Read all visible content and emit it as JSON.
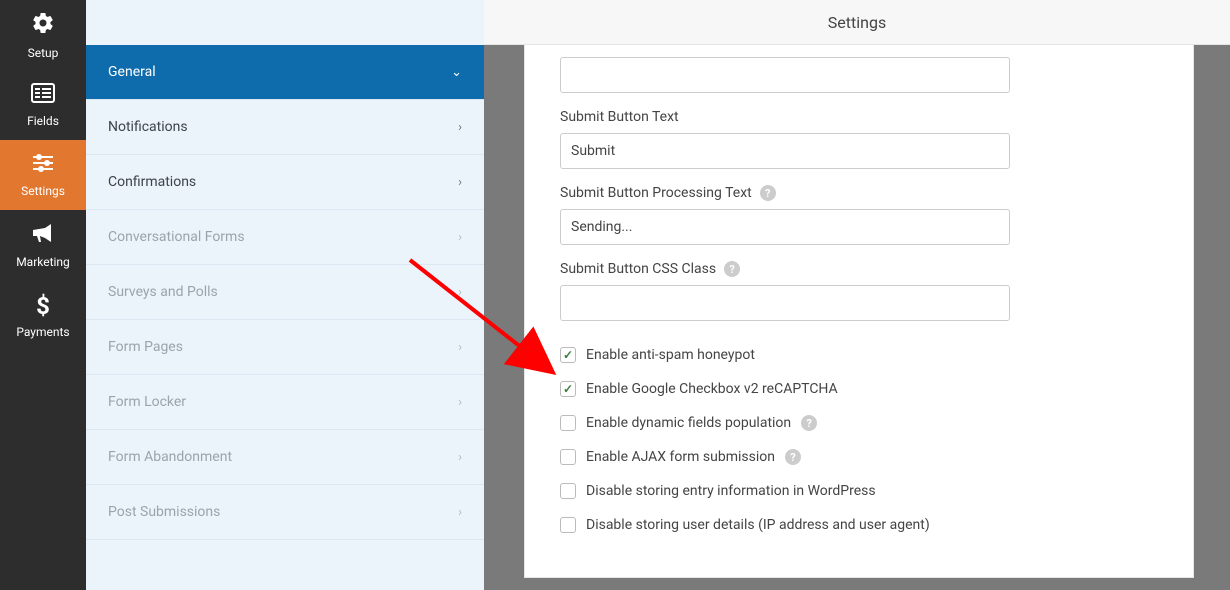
{
  "sidebar": {
    "items": [
      {
        "label": "Setup"
      },
      {
        "label": "Fields"
      },
      {
        "label": "Settings"
      },
      {
        "label": "Marketing"
      },
      {
        "label": "Payments"
      }
    ]
  },
  "panel": {
    "items": [
      {
        "label": "General",
        "active": true,
        "expanded": true
      },
      {
        "label": "Notifications"
      },
      {
        "label": "Confirmations"
      },
      {
        "label": "Conversational Forms",
        "muted": true
      },
      {
        "label": "Surveys and Polls",
        "muted": true
      },
      {
        "label": "Form Pages",
        "muted": true
      },
      {
        "label": "Form Locker",
        "muted": true
      },
      {
        "label": "Form Abandonment",
        "muted": true
      },
      {
        "label": "Post Submissions",
        "muted": true
      }
    ]
  },
  "header": {
    "title": "Settings"
  },
  "form": {
    "submit_text_label": "Submit Button Text",
    "submit_text_value": "Submit",
    "processing_label": "Submit Button Processing Text",
    "processing_value": "Sending...",
    "css_class_label": "Submit Button CSS Class",
    "css_class_value": ""
  },
  "checkboxes": [
    {
      "label": "Enable anti-spam honeypot",
      "checked": true,
      "help": false
    },
    {
      "label": "Enable Google Checkbox v2 reCAPTCHA",
      "checked": true,
      "help": false
    },
    {
      "label": "Enable dynamic fields population",
      "checked": false,
      "help": true
    },
    {
      "label": "Enable AJAX form submission",
      "checked": false,
      "help": true
    },
    {
      "label": "Disable storing entry information in WordPress",
      "checked": false,
      "help": false
    },
    {
      "label": "Disable storing user details (IP address and user agent)",
      "checked": false,
      "help": false
    }
  ]
}
